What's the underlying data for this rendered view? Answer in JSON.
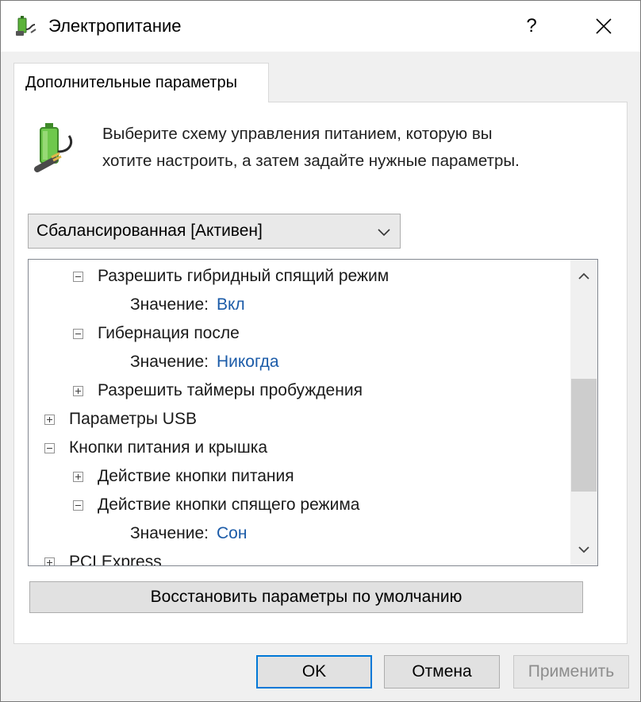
{
  "window": {
    "title": "Электропитание",
    "help_label": "?",
    "close_label": "✕"
  },
  "tab": {
    "label": "Дополнительные параметры"
  },
  "description": {
    "line1": "Выберите схему управления питанием, которую вы",
    "line2": "хотите настроить, а затем задайте нужные параметры."
  },
  "plan_select": {
    "value": "Сбалансированная [Активен]"
  },
  "tree": {
    "value_label": "Значение:",
    "items": [
      {
        "label": "PCI Express",
        "expanded": false
      },
      {
        "label": "Разрешить гибридный спящий режим",
        "expanded": true,
        "value": "Вкл"
      },
      {
        "label": "Гибернация после",
        "expanded": true,
        "value": "Никогда"
      },
      {
        "label": "Разрешить таймеры пробуждения",
        "expanded": false
      },
      {
        "label": "Параметры USB",
        "expanded": false
      },
      {
        "label": "Кнопки питания и крышка",
        "expanded": true
      },
      {
        "label": "Действие кнопки питания",
        "expanded": false
      },
      {
        "label": "Действие кнопки спящего режима",
        "expanded": true,
        "value": "Сон"
      }
    ]
  },
  "restore_button": {
    "label": "Восстановить параметры по умолчанию"
  },
  "buttons": {
    "ok": "OK",
    "cancel": "Отмена",
    "apply": "Применить"
  },
  "colors": {
    "accent": "#0078d7",
    "value_text": "#1b5ba8",
    "battery": "#4caf35"
  },
  "icons": {
    "app": "power-plug-icon",
    "battery": "battery-plug-icon",
    "dropdown": "chevron-down-icon",
    "scroll_up": "chevron-up-icon",
    "scroll_down": "chevron-down-icon"
  }
}
